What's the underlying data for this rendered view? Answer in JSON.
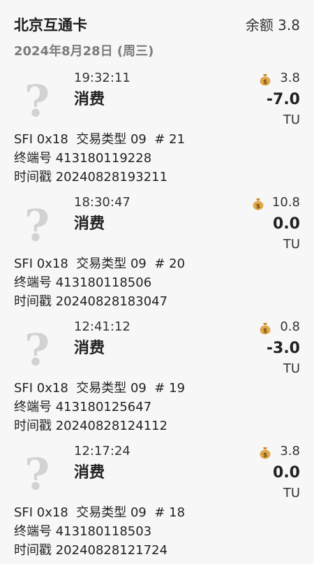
{
  "header": {
    "card_name": "北京互通卡",
    "balance_text": "余额 3.8"
  },
  "date_label": "2024年8月28日 (周三)",
  "transactions": [
    {
      "time": "19:32:11",
      "type": "消费",
      "balance_after": "3.8",
      "amount": "-7.0",
      "unit": "TU",
      "sfi_line": "SFI 0x18  交易类型 09  # 21",
      "terminal_line": "终端号 413180119228",
      "timestamp_line": "时间戳 20240828193211",
      "icon": "money-bag-icon"
    },
    {
      "time": "18:30:47",
      "type": "消费",
      "balance_after": "10.8",
      "amount": "0.0",
      "unit": "TU",
      "sfi_line": "SFI 0x18  交易类型 09  # 20",
      "terminal_line": "终端号 413180118506",
      "timestamp_line": "时间戳 20240828183047",
      "icon": "money-bag-icon"
    },
    {
      "time": "12:41:12",
      "type": "消费",
      "balance_after": "0.8",
      "amount": "-3.0",
      "unit": "TU",
      "sfi_line": "SFI 0x18  交易类型 09  # 19",
      "terminal_line": "终端号 413180125647",
      "timestamp_line": "时间戳 20240828124112",
      "icon": "money-bag-icon"
    },
    {
      "time": "12:17:24",
      "type": "消费",
      "balance_after": "3.8",
      "amount": "0.0",
      "unit": "TU",
      "sfi_line": "SFI 0x18  交易类型 09  # 18",
      "terminal_line": "终端号 413180118503",
      "timestamp_line": "时间戳 20240828121724",
      "icon": "money-bag-icon"
    }
  ],
  "placeholder_icon": "question-mark-icon",
  "colors": {
    "background": "#f7f7f7",
    "placeholder_gray": "#d2d2d2",
    "money_bag": "#e0a84a"
  }
}
